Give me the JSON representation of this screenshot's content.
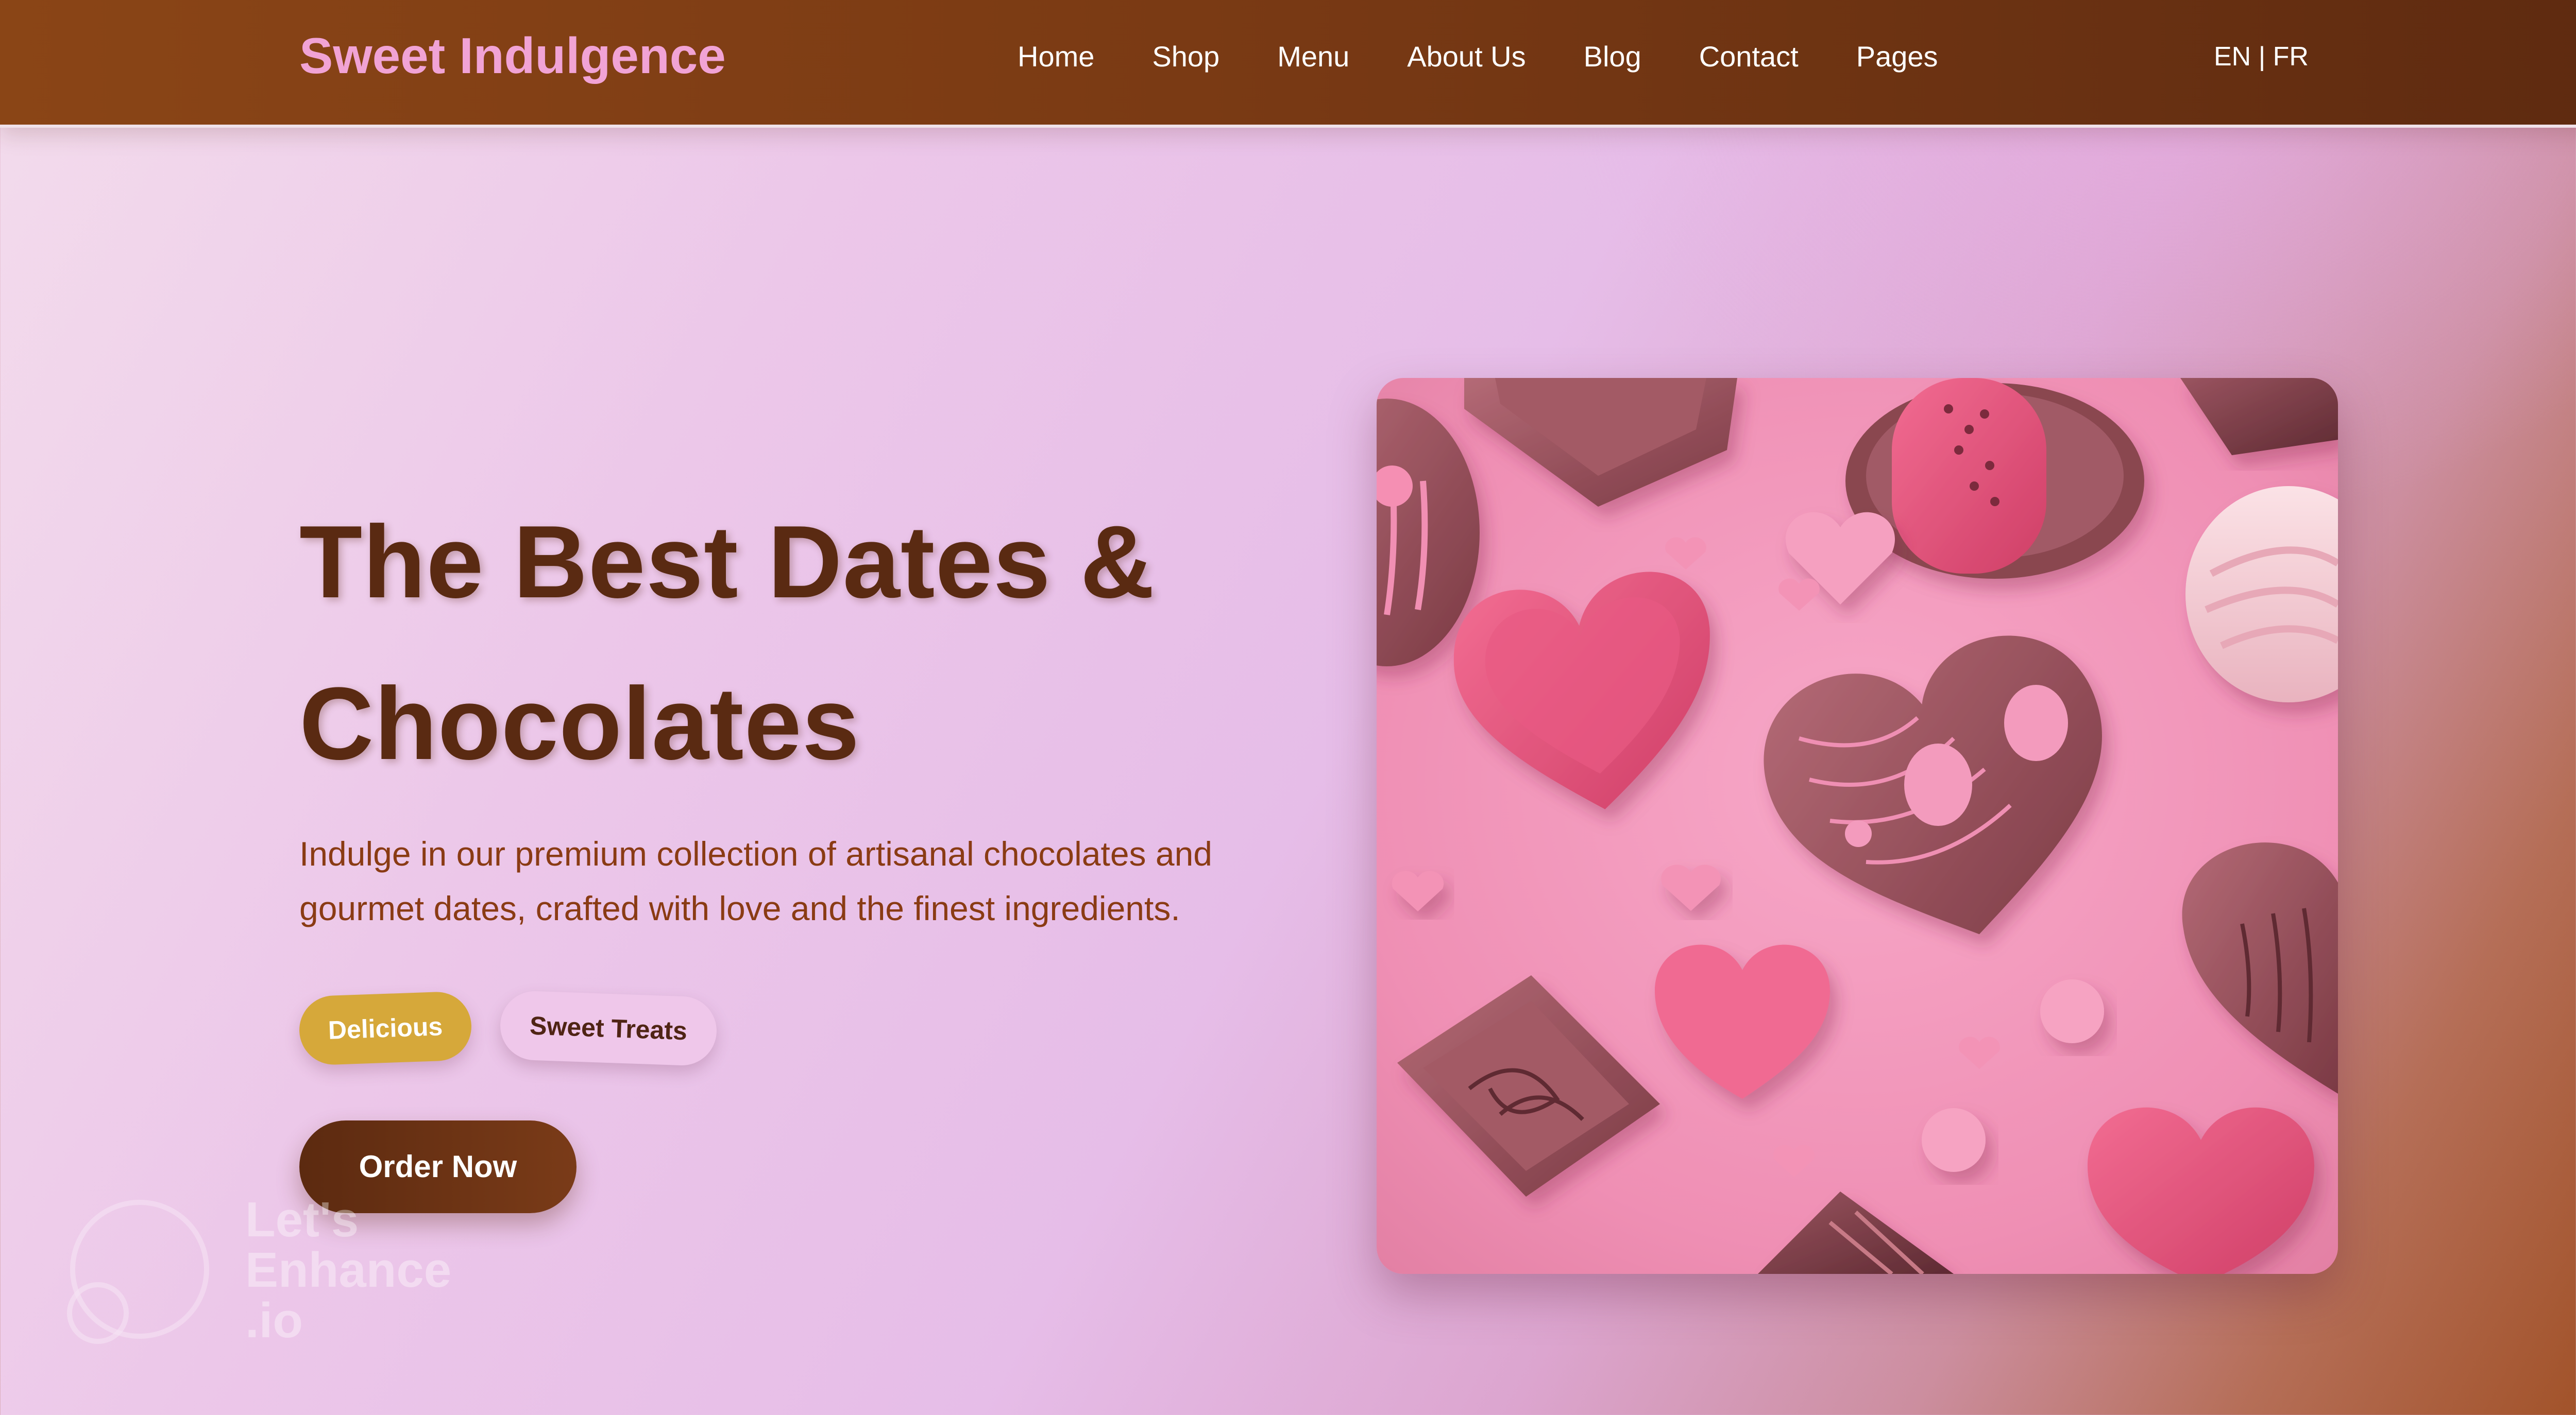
{
  "header": {
    "brand": "Sweet Indulgence",
    "nav": [
      "Home",
      "Shop",
      "Menu",
      "About Us",
      "Blog",
      "Contact",
      "Pages"
    ],
    "lang": {
      "en": "EN",
      "separator": "|",
      "fr": "FR"
    }
  },
  "hero": {
    "title_line1": "The Best Dates &",
    "title_line2": "Chocolates",
    "description": "Indulge in our premium collection of artisanal chocolates and gourmet dates, crafted with love and the finest ingredients.",
    "tags": [
      "Delicious",
      "Sweet Treats"
    ],
    "cta_label": "Order Now",
    "image_subject": "pink-chocolate-hearts-photo"
  },
  "watermark": {
    "text": "Let's\nEnhance\n.io"
  },
  "colors": {
    "header_bg": "#7a3a14",
    "brand": "#f1a3d5",
    "title": "#5a2a12",
    "description": "#8a3b14",
    "tag_delicious": "#d6a83a",
    "tag_sweet": "#efc7ea",
    "cta_bg": "#6b3212"
  }
}
